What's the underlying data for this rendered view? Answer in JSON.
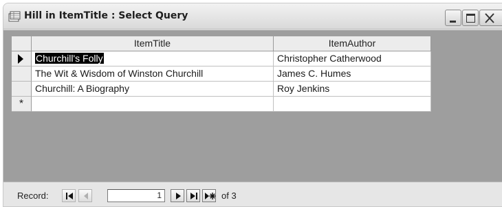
{
  "window": {
    "title": "Hill in ItemTitle : Select Query"
  },
  "datasheet": {
    "columns": [
      "ItemTitle",
      "ItemAuthor"
    ],
    "rows": [
      {
        "ItemTitle": "Churchill's Folly",
        "ItemAuthor": "Christopher Catherwood"
      },
      {
        "ItemTitle": "The Wit & Wisdom of Winston Churchill",
        "ItemAuthor": "James C. Humes"
      },
      {
        "ItemTitle": "Churchill: A Biography",
        "ItemAuthor": "Roy Jenkins"
      }
    ],
    "current_row": 1,
    "new_row_marker": "*"
  },
  "navigation": {
    "record_label": "Record:",
    "current_record": "1",
    "total_text": "of 3"
  }
}
